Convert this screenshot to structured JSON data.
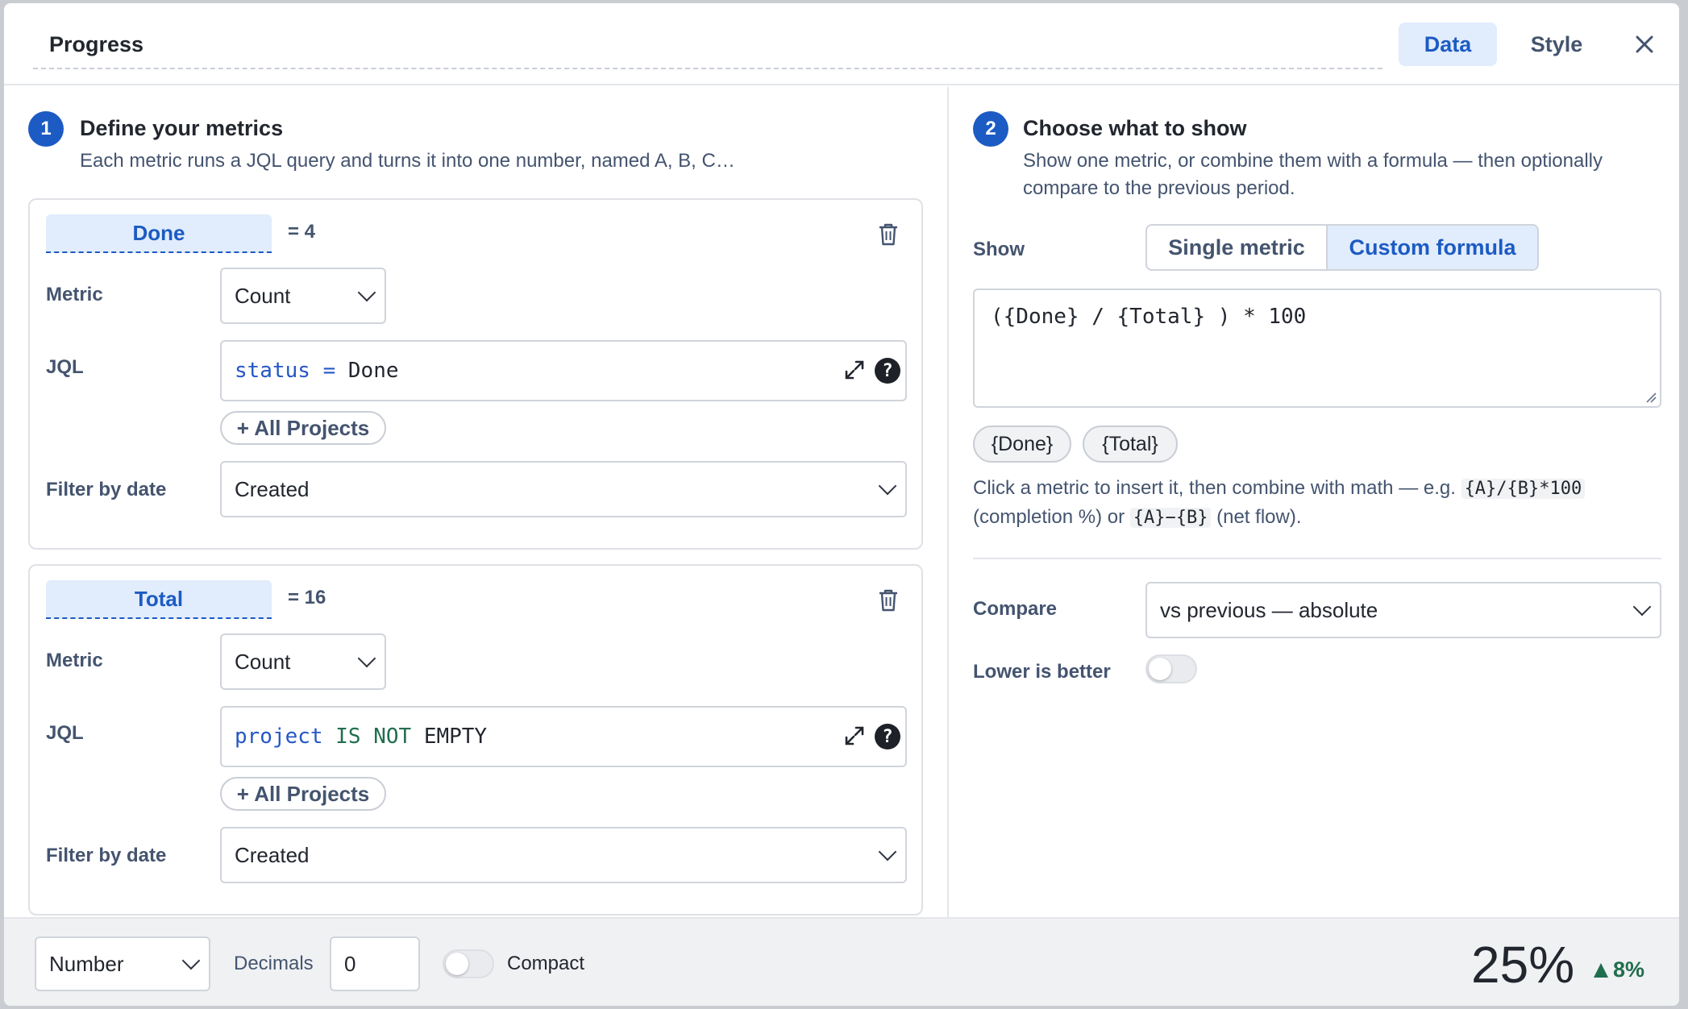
{
  "header": {
    "title": "Progress",
    "tabs": [
      "Data",
      "Style"
    ]
  },
  "step1": {
    "number": "1",
    "title": "Define your metrics",
    "description": "Each metric runs a JQL query and turns it into one number, named A, B, C…"
  },
  "metrics": [
    {
      "name": "Done",
      "result": "= 4",
      "metric_label": "Metric",
      "metric_value": "Count",
      "jql_label": "JQL",
      "jql_tokens": {
        "t1": "status",
        "t2": "=",
        "t3": "Done"
      },
      "projects_button": "+ All Projects",
      "filter_label": "Filter by date",
      "filter_value": "Created"
    },
    {
      "name": "Total",
      "result": "= 16",
      "metric_label": "Metric",
      "metric_value": "Count",
      "jql_label": "JQL",
      "jql_tokens": {
        "t1": "project",
        "t2": "IS NOT",
        "t3": "EMPTY"
      },
      "projects_button": "+ All Projects",
      "filter_label": "Filter by date",
      "filter_value": "Created"
    }
  ],
  "step2": {
    "number": "2",
    "title": "Choose what to show",
    "description_line1": "Show one metric, or combine them with a formula — then optionally",
    "description_line2": "compare to the previous period."
  },
  "show": {
    "label": "Show",
    "options": [
      "Single metric",
      "Custom formula"
    ],
    "selected": "Custom formula"
  },
  "formula": {
    "value": "({Done} / {Total} ) * 100",
    "tokens": [
      "{Done}",
      "{Total}"
    ],
    "hint_part1": "Click a metric to insert it, then combine with math — e.g. ",
    "hint_code1": "{A}/{B}*100",
    "hint_part2": "(completion %) or ",
    "hint_code2": "{A}−{B}",
    "hint_part3": " (net flow)."
  },
  "compare": {
    "label": "Compare",
    "value": "vs previous — absolute"
  },
  "lower_is_better": {
    "label": "Lower is better",
    "enabled": false
  },
  "footer": {
    "format_value": "Number",
    "decimals_label": "Decimals",
    "decimals_value": "0",
    "compact_label": "Compact",
    "compact_enabled": false,
    "preview_value": "25%",
    "preview_delta": "8%"
  },
  "colors": {
    "accent": "#1c5bc3",
    "accent_bg": "#e1ecfc",
    "positive": "#216e4e"
  },
  "icons": [
    "close-icon",
    "trash-icon",
    "expand-icon",
    "help-icon",
    "chevron-down-icon",
    "resize-handle-icon",
    "triangle-up-icon"
  ]
}
